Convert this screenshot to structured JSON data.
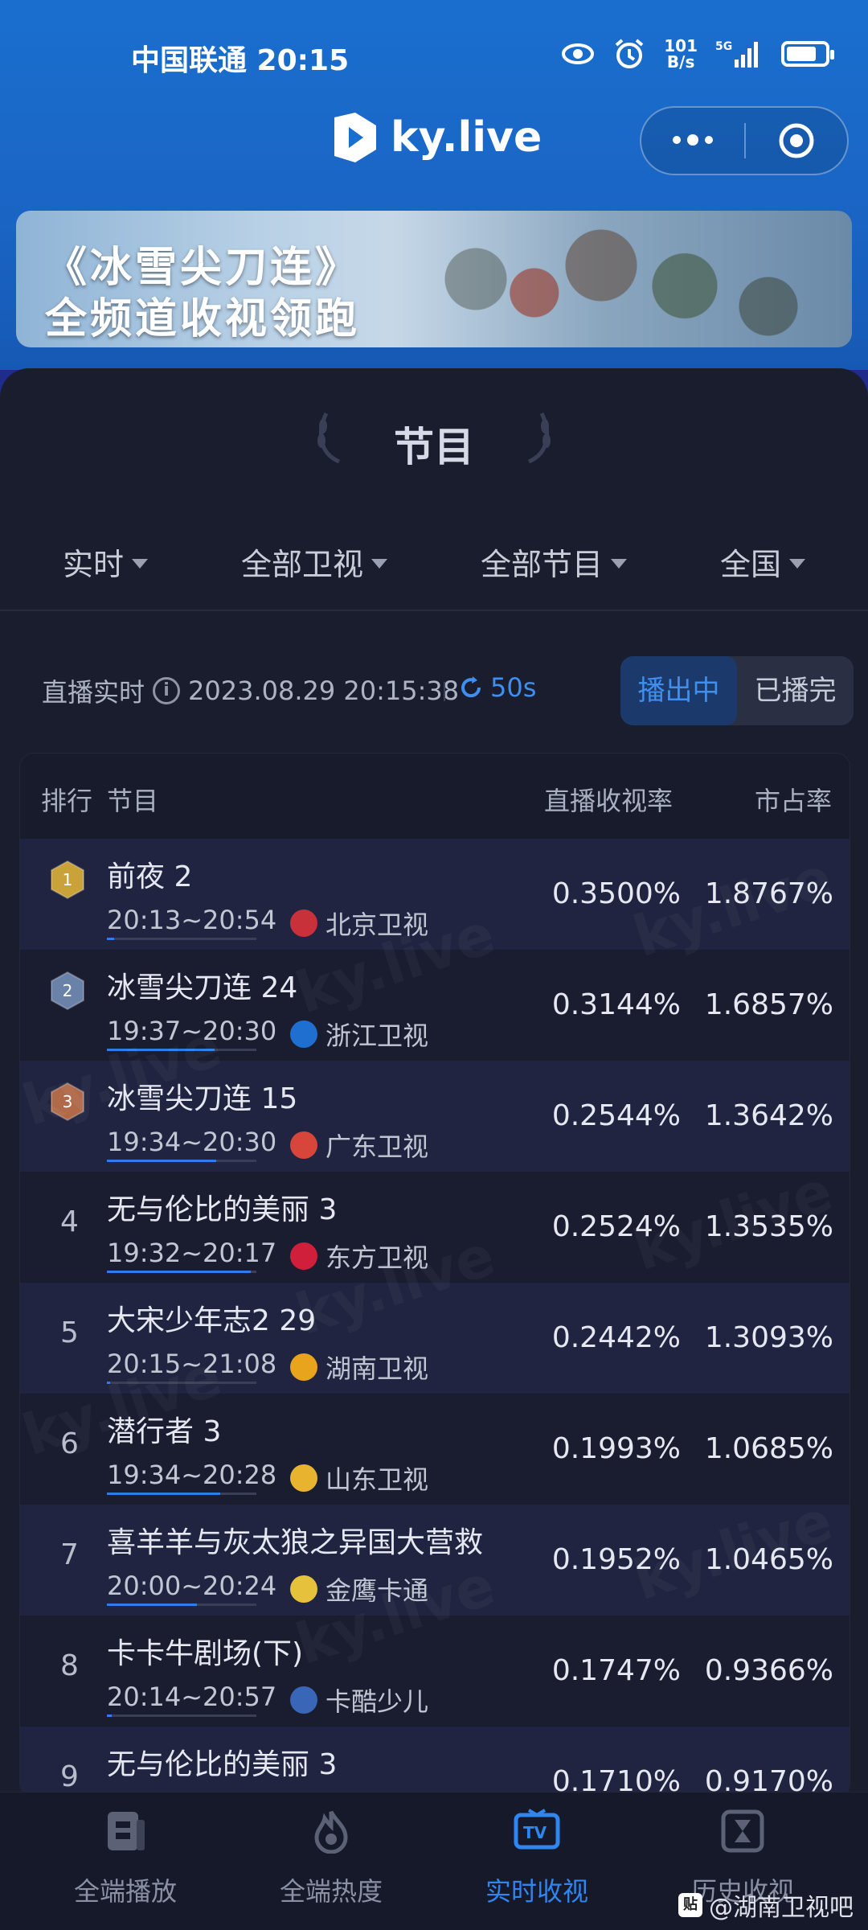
{
  "status_bar": {
    "carrier_time": "中国联通 20:15",
    "net_speed_value": "101",
    "net_speed_unit": "B/s",
    "signal": "5G"
  },
  "header": {
    "brand": "ky.live"
  },
  "banner": {
    "line1": "《冰雪尖刀连》",
    "line2": "全频道收视领跑"
  },
  "section_title": "节目",
  "filters": [
    {
      "label": "实时"
    },
    {
      "label": "全部卫视"
    },
    {
      "label": "全部节目"
    },
    {
      "label": "全国"
    }
  ],
  "live": {
    "label": "直播实时",
    "timestamp": "2023.08.29 20:15:38",
    "refresh": "50s",
    "tab_on_air": "播出中",
    "tab_finished": "已播完"
  },
  "table": {
    "headers": {
      "rank": "排行",
      "program": "节目",
      "rating": "直播收视率",
      "share": "市占率"
    },
    "rows": [
      {
        "rank": "1",
        "name": "前夜 2",
        "time": "20:13~20:54",
        "channel": "北京卫视",
        "rating": "0.3500%",
        "share": "1.8767%",
        "progress": 0.05
      },
      {
        "rank": "2",
        "name": "冰雪尖刀连 24",
        "time": "19:37~20:30",
        "channel": "浙江卫视",
        "rating": "0.3144%",
        "share": "1.6857%",
        "progress": 0.72
      },
      {
        "rank": "3",
        "name": "冰雪尖刀连 15",
        "time": "19:34~20:30",
        "channel": "广东卫视",
        "rating": "0.2544%",
        "share": "1.3642%",
        "progress": 0.73
      },
      {
        "rank": "4",
        "name": "无与伦比的美丽 3",
        "time": "19:32~20:17",
        "channel": "东方卫视",
        "rating": "0.2524%",
        "share": "1.3535%",
        "progress": 0.96
      },
      {
        "rank": "5",
        "name": "大宋少年志2 29",
        "time": "20:15~21:08",
        "channel": "湖南卫视",
        "rating": "0.2442%",
        "share": "1.3093%",
        "progress": 0.02
      },
      {
        "rank": "6",
        "name": "潜行者 3",
        "time": "19:34~20:28",
        "channel": "山东卫视",
        "rating": "0.1993%",
        "share": "1.0685%",
        "progress": 0.76
      },
      {
        "rank": "7",
        "name": "喜羊羊与灰太狼之异国大营救",
        "time": "20:00~20:24",
        "channel": "金鹰卡通",
        "rating": "0.1952%",
        "share": "1.0465%",
        "progress": 0.6
      },
      {
        "rank": "8",
        "name": "卡卡牛剧场(下)",
        "time": "20:14~20:57",
        "channel": "卡酷少儿",
        "rating": "0.1747%",
        "share": "0.9366%",
        "progress": 0.03
      },
      {
        "rank": "9",
        "name": "无与伦比的美丽 3",
        "time": "",
        "channel": "",
        "rating": "0.1710%",
        "share": "0.9170%",
        "progress": 0
      }
    ]
  },
  "bottom_nav": [
    {
      "label": "全端播放"
    },
    {
      "label": "全端热度"
    },
    {
      "label": "实时收视"
    },
    {
      "label": "历史收视"
    }
  ],
  "watermark_credit": "@湖南卫视吧",
  "colors": {
    "accent_blue": "#2f86f0",
    "header_blue": "#1a6fce",
    "panel_bg": "#1a1d2e",
    "gold": "#c9a23a",
    "silver": "#6a82a8",
    "bronze": "#b06a4a"
  }
}
